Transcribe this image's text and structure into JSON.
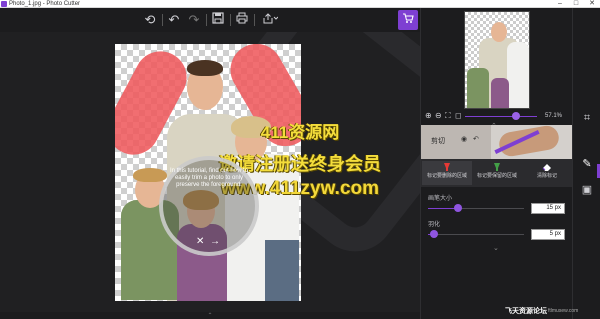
{
  "window": {
    "title": "Photo_1.jpg - Photo Cutter",
    "min": "–",
    "max": "□",
    "close": "✕"
  },
  "toolbar": {
    "icons": [
      "back-icon",
      "undo-icon",
      "redo-icon",
      "save-icon",
      "print-icon",
      "share-icon"
    ],
    "undo": "↶",
    "redo": "↷",
    "back": "⟲",
    "save": "💾",
    "print": "⎙",
    "share": "⇪",
    "cart": "🛒",
    "accent": "#7e3fd2"
  },
  "canvas": {
    "watermark_line1": "411资源网",
    "watermark_line2": "邀请注册送终身会员",
    "watermark_line3": "www.411zyw.com",
    "tutorial_text": "In this tutorial, find out how to easily trim a photo to only preserve the foreground.",
    "tutorial_close": "✕",
    "tutorial_next": "→",
    "bottom_handle": "⌃"
  },
  "panel": {
    "zoom_value": "57.1%",
    "zoom_level_fraction": 0.66,
    "banner_label": "剪切",
    "tools": [
      {
        "label": "标记要删除的区域",
        "color": "#e53935"
      },
      {
        "label": "标记要保留的区域",
        "color": "#43a047"
      },
      {
        "label": "清除标记",
        "color": "#ffffff"
      }
    ],
    "brush_size": {
      "label": "画笔大小",
      "value": "15 px",
      "fraction": 0.3
    },
    "feather": {
      "label": "羽化",
      "value": "5 px",
      "fraction": 0.05
    }
  },
  "corner": {
    "text": "飞天资源论坛",
    "url": "ftlmusew.com"
  }
}
